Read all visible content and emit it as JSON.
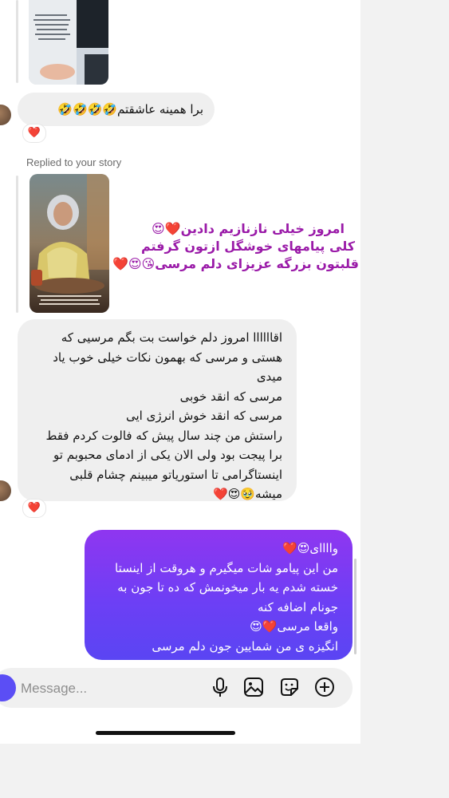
{
  "thread": {
    "message_1_text": "برا همینه عاشقتم🤣🤣🤣🤣",
    "reaction_1": "❤️",
    "reply_caption": "Replied to your story",
    "story_overlay": {
      "line_1": "امروز خیلی نازنازیم دادین❤️😍",
      "line_2": "کلی پیامهای خوشگل ازتون گرفتم",
      "line_3": "قلبتون بزرگه عزیزای دلم مرسی😘😍❤️"
    },
    "message_2_lines": [
      "اقاااااا امروز دلم خواست بت بگم مرسیی که",
      "هستی و مرسی که بهمون نکات خیلی خوب یاد",
      "میدی",
      "مرسی که انقد خوبی",
      "مرسی که انقد خوش انرژی ایی",
      "راستش من چند سال پیش که فالوت کردم فقط",
      "برا پیجت بود ولی الان یکی از ادمای محبوبم تو",
      "اینستاگرامی تا استوریاتو میبینم چشام قلبی",
      "میشه🥹😍❤️"
    ],
    "reaction_2": "❤️",
    "my_reply_lines": [
      "واااای😍❤️",
      "من این پیامو شات میگیرم و هروقت از اینستا",
      "خسته شدم یه بار میخونمش که ده تا جون به",
      "جونام اضافه کنه",
      "واقعا مرسی❤️😍",
      "انگیزه ی من شمایین جون دلم مرسی"
    ]
  },
  "composer": {
    "placeholder": "Message...",
    "icons": [
      "camera-icon",
      "microphone-icon",
      "gallery-icon",
      "sticker-icon",
      "add-icon"
    ]
  },
  "colors": {
    "sent_bubble_top": "#8f36f0",
    "sent_bubble_bottom": "#5a45f3",
    "received_bubble": "#efefef",
    "overlay_text": "#9a1aa8",
    "reaction_heart": "#e2163b"
  }
}
